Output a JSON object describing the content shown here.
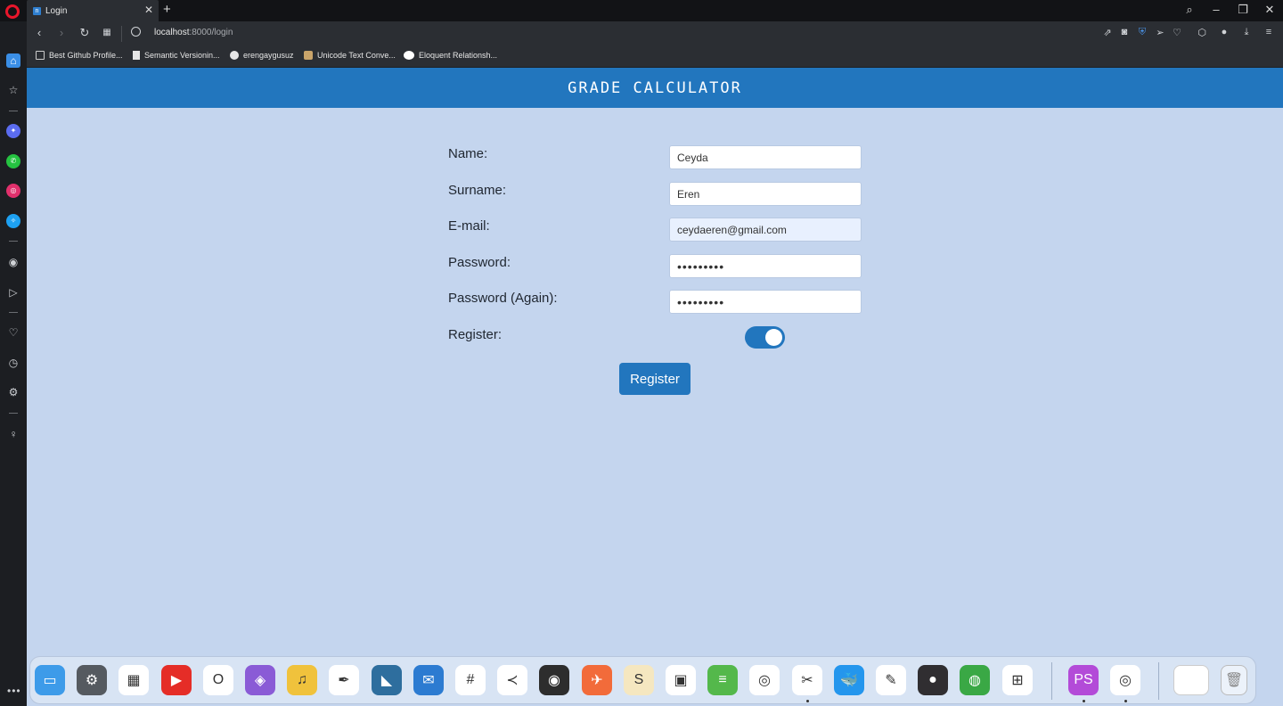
{
  "browser": {
    "tab_title": "Login",
    "tab_favicon": "n",
    "address_host": "localhost",
    "address_path": ":8000/login",
    "bookmarks": [
      {
        "label": "Best Github Profile...",
        "icon": "folder-icon"
      },
      {
        "label": "Semantic Versionin...",
        "icon": "document-icon"
      },
      {
        "label": "erengaygusuz",
        "icon": "github-icon"
      },
      {
        "label": "Unicode Text Conve...",
        "icon": "unicode-icon"
      },
      {
        "label": "Eloquent Relationsh...",
        "icon": "medium-icon"
      }
    ]
  },
  "app": {
    "title": "Grade Calculator"
  },
  "form": {
    "name_label": "Name:",
    "name_value": "Ceyda",
    "surname_label": "Surname:",
    "surname_value": "Eren",
    "email_label": "E-mail:",
    "email_value": "ceydaeren@gmail.com",
    "password_label": "Password:",
    "password_value": "123456789",
    "password_again_label": "Password (Again):",
    "password_again_value": "123456789",
    "register_label": "Register:",
    "register_toggle_on": true,
    "submit_label": "Register"
  },
  "colors": {
    "header": "#2276be",
    "page_bg": "#c4d5ee",
    "accent": "#2276be"
  },
  "dock": {
    "apps": [
      {
        "name": "files-app",
        "color": "#3d9be9",
        "glyph": "▭"
      },
      {
        "name": "settings-app",
        "color": "#555a60",
        "glyph": "⚙"
      },
      {
        "name": "launcher-app",
        "color": "#ffffff",
        "glyph": "▦"
      },
      {
        "name": "youtube-app",
        "color": "#e52d27",
        "glyph": "▶"
      },
      {
        "name": "opera-app",
        "color": "#ffffff",
        "glyph": "O"
      },
      {
        "name": "visual-studio-app",
        "color": "#8a5bd6",
        "glyph": "◈"
      },
      {
        "name": "audacity-app",
        "color": "#f0c23c",
        "glyph": "♫"
      },
      {
        "name": "inkscape-app",
        "color": "#ffffff",
        "glyph": "✒"
      },
      {
        "name": "mysql-workbench-app",
        "color": "#2e6e9e",
        "glyph": "◣"
      },
      {
        "name": "thunderbird-app",
        "color": "#2c7bd1",
        "glyph": "✉"
      },
      {
        "name": "slack-app",
        "color": "#ffffff",
        "glyph": "#"
      },
      {
        "name": "vscode-app",
        "color": "#ffffff",
        "glyph": "≺"
      },
      {
        "name": "jupyter-app",
        "color": "#2d2d2d",
        "glyph": "◉"
      },
      {
        "name": "postman-app",
        "color": "#f26b3a",
        "glyph": "✈"
      },
      {
        "name": "sublime-app",
        "color": "#f5e7c0",
        "glyph": "S"
      },
      {
        "name": "virtualbox-app",
        "color": "#ffffff",
        "glyph": "▣"
      },
      {
        "name": "bluestacks-app",
        "color": "#54b84b",
        "glyph": "≡"
      },
      {
        "name": "maps-app",
        "color": "#ffffff",
        "glyph": "◎"
      },
      {
        "name": "snipping-app",
        "color": "#ffffff",
        "glyph": "✂"
      },
      {
        "name": "docker-app",
        "color": "#2496ed",
        "glyph": "🐳"
      },
      {
        "name": "gimp-app",
        "color": "#ffffff",
        "glyph": "✎"
      },
      {
        "name": "obs-app",
        "color": "#302e31",
        "glyph": "●"
      },
      {
        "name": "torrent-app",
        "color": "#3aa845",
        "glyph": "◍"
      },
      {
        "name": "windows-app",
        "color": "#ffffff",
        "glyph": "⊞"
      }
    ],
    "pinned": [
      {
        "name": "phpstorm-app",
        "color": "#b34bd8",
        "glyph": "PS"
      },
      {
        "name": "maps-app-running",
        "color": "#ffffff",
        "glyph": "◎"
      }
    ]
  }
}
